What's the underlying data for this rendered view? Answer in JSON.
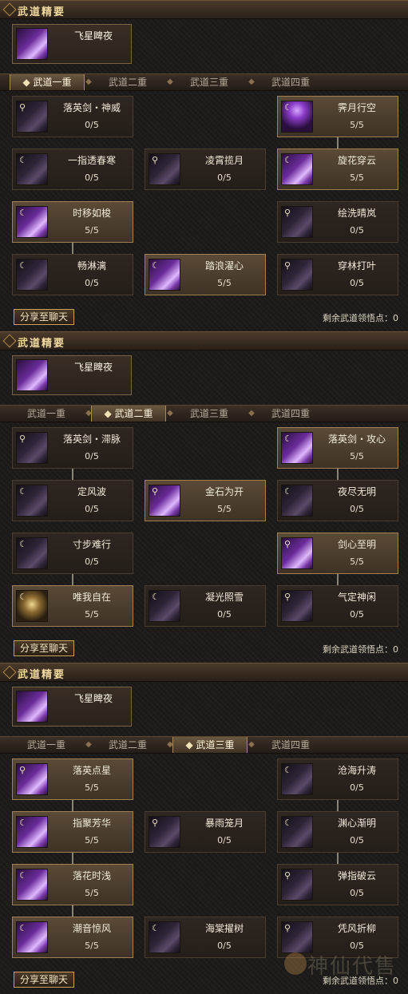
{
  "feature_label": "武道精要",
  "feature_skill": "飞星睥夜",
  "tabs": [
    "武道一重",
    "武道二重",
    "武道三重",
    "武道四重"
  ],
  "share_label": "分享至聊天",
  "remaining_label": "剩余武道领悟点：",
  "watermark": "神仙代售",
  "panels": [
    {
      "active_tab": 0,
      "remaining": "0",
      "skills": [
        {
          "name": "落英剑・神威",
          "points": "0/5",
          "lit": false
        },
        {
          "name": "霁月行空",
          "points": "5/5",
          "lit": true
        },
        {
          "name": "一指透春寒",
          "points": "0/5",
          "lit": false
        },
        {
          "name": "凌霄揽月",
          "points": "0/5",
          "lit": false
        },
        {
          "name": "旋花穿云",
          "points": "5/5",
          "lit": true
        },
        {
          "name": "时移如梭",
          "points": "5/5",
          "lit": true
        },
        {
          "name": "绘洗晴岚",
          "points": "0/5",
          "lit": false
        },
        {
          "name": "畅淋漓",
          "points": "0/5",
          "lit": false
        },
        {
          "name": "踏浪濯心",
          "points": "5/5",
          "lit": true
        },
        {
          "name": "穿林打叶",
          "points": "0/5",
          "lit": false
        }
      ]
    },
    {
      "active_tab": 1,
      "remaining": "0",
      "skills": [
        {
          "name": "落英剑・滞脉",
          "points": "0/5",
          "lit": false
        },
        {
          "name": "落英剑・攻心",
          "points": "5/5",
          "lit": true
        },
        {
          "name": "定风波",
          "points": "0/5",
          "lit": false
        },
        {
          "name": "金石为开",
          "points": "5/5",
          "lit": true
        },
        {
          "name": "夜尽无明",
          "points": "0/5",
          "lit": false
        },
        {
          "name": "寸步难行",
          "points": "0/5",
          "lit": false
        },
        {
          "name": "剑心至明",
          "points": "5/5",
          "lit": true
        },
        {
          "name": "唯我自在",
          "points": "5/5",
          "lit": true
        },
        {
          "name": "凝光照雪",
          "points": "0/5",
          "lit": false
        },
        {
          "name": "气定神闲",
          "points": "0/5",
          "lit": false
        }
      ]
    },
    {
      "active_tab": 2,
      "remaining": "0",
      "skills": [
        {
          "name": "落英点星",
          "points": "5/5",
          "lit": true
        },
        {
          "name": "沧海升涛",
          "points": "0/5",
          "lit": false
        },
        {
          "name": "指聚芳华",
          "points": "5/5",
          "lit": true
        },
        {
          "name": "暴雨笼月",
          "points": "0/5",
          "lit": false
        },
        {
          "name": "渊心渐明",
          "points": "0/5",
          "lit": false
        },
        {
          "name": "落花时浅",
          "points": "5/5",
          "lit": true
        },
        {
          "name": "弹指破云",
          "points": "0/5",
          "lit": false
        },
        {
          "name": "潮音惊风",
          "points": "5/5",
          "lit": true
        },
        {
          "name": "海棠擢树",
          "points": "0/5",
          "lit": false
        },
        {
          "name": "凭风折柳",
          "points": "0/5",
          "lit": false
        }
      ]
    }
  ]
}
